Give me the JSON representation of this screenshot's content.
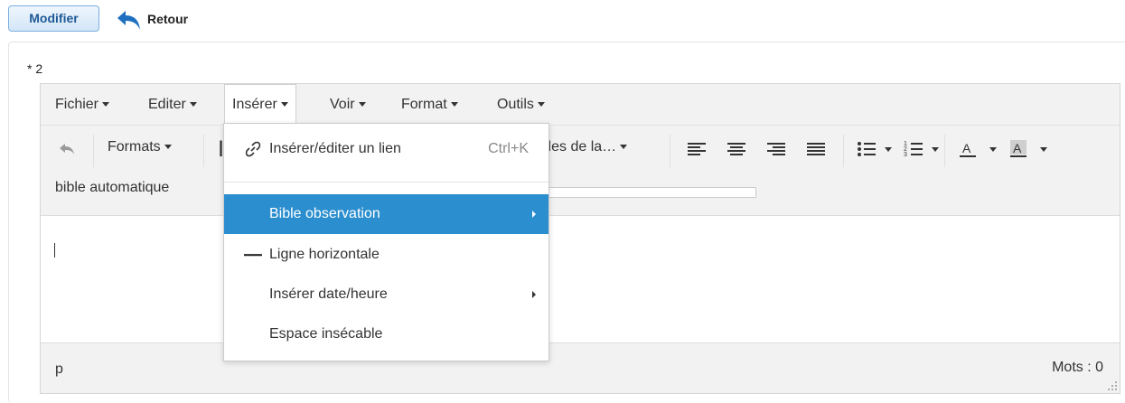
{
  "top": {
    "modifier_label": "Modifier",
    "retour_label": "Retour"
  },
  "field": {
    "label": "* 2"
  },
  "menubar": {
    "items": [
      {
        "label": "Fichier"
      },
      {
        "label": "Editer"
      },
      {
        "label": "Insérer"
      },
      {
        "label": "Voir"
      },
      {
        "label": "Format"
      },
      {
        "label": "Outils"
      }
    ]
  },
  "toolbar": {
    "formats_label": "Formats",
    "style_label": "lles de la…",
    "custom_label": "bible automatique",
    "icons": [
      "undo-icon",
      "align-left-icon",
      "align-center-icon",
      "align-right-icon",
      "align-justify-icon",
      "bullet-list-icon",
      "numbered-list-icon",
      "text-color-icon",
      "background-color-icon"
    ]
  },
  "dropdown": {
    "link_label": "Insérer/éditer un lien",
    "link_shortcut": "Ctrl+K",
    "bible_label": "Bible observation",
    "hr_label": "Ligne horizontale",
    "date_label": "Insérer date/heure",
    "nbsp_label": "Espace insécable"
  },
  "status": {
    "path": "p",
    "words": "Mots : 0"
  },
  "colors": {
    "accent": "#2b8ecf",
    "button_text": "#1f5a96"
  }
}
